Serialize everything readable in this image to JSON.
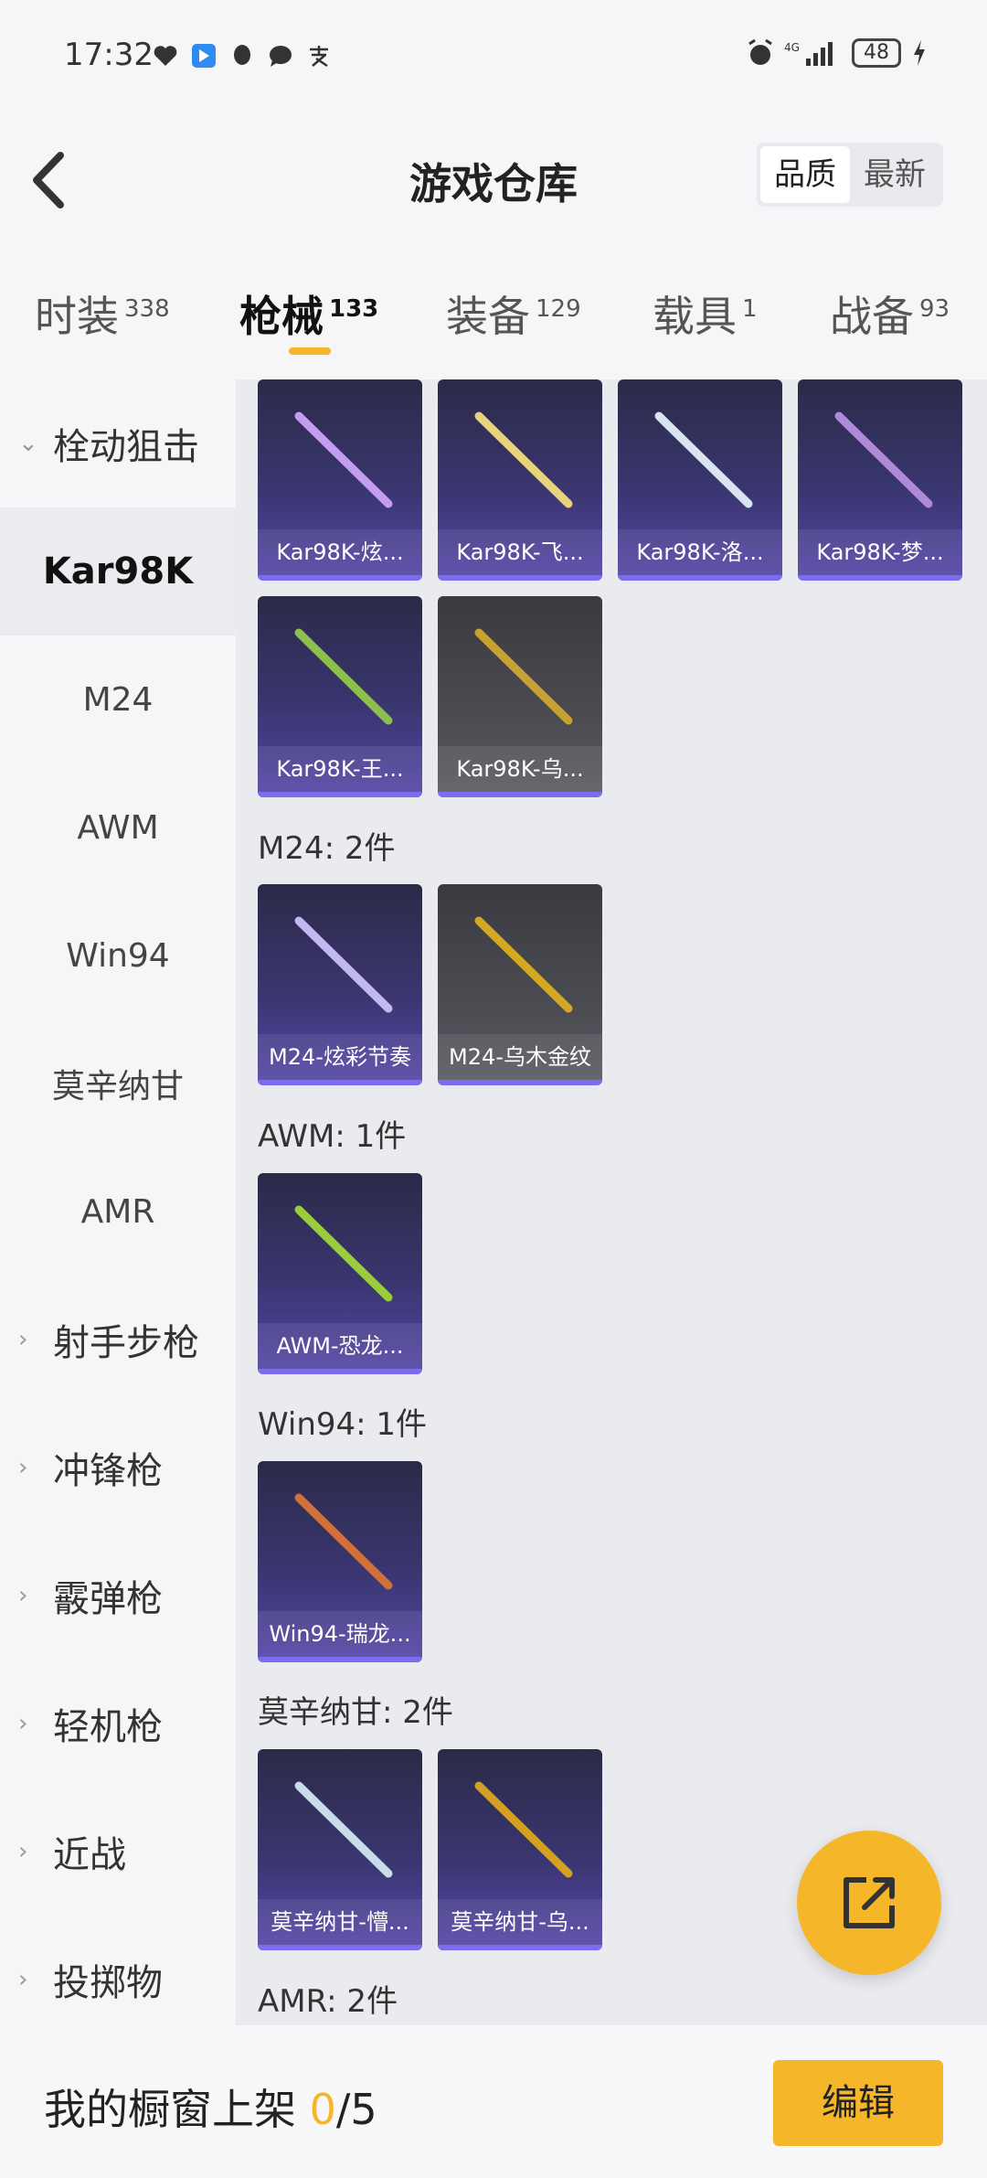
{
  "status_bar": {
    "time": "17:32",
    "battery": "48",
    "net": "4G"
  },
  "header": {
    "title": "游戏仓库",
    "sort_options": [
      "品质",
      "最新"
    ]
  },
  "tabs": [
    {
      "label": "时装",
      "count": "338"
    },
    {
      "label": "枪械",
      "count": "133"
    },
    {
      "label": "装备",
      "count": "129"
    },
    {
      "label": "载具",
      "count": "1"
    },
    {
      "label": "战备",
      "count": "93"
    }
  ],
  "sidebar": [
    {
      "label": "栓动狙击",
      "chevron": "⌄"
    },
    {
      "label": "Kar98K"
    },
    {
      "label": "M24"
    },
    {
      "label": "AWM"
    },
    {
      "label": "Win94"
    },
    {
      "label": "莫辛纳甘"
    },
    {
      "label": "AMR"
    },
    {
      "label": "射手步枪",
      "chevron": "›"
    },
    {
      "label": "冲锋枪",
      "chevron": "›"
    },
    {
      "label": "霰弹枪",
      "chevron": "›"
    },
    {
      "label": "轻机枪",
      "chevron": "›"
    },
    {
      "label": "近战",
      "chevron": "›"
    },
    {
      "label": "投掷物",
      "chevron": "›"
    }
  ],
  "sections": [
    "M24: 2件",
    "AWM: 1件",
    "Win94: 1件",
    "莫辛纳甘: 2件",
    "AMR: 2件"
  ],
  "items": [
    {
      "name": "Kar98K-炫...",
      "color": "#c49cf0"
    },
    {
      "name": "Kar98K-飞...",
      "color": "#e8d27a"
    },
    {
      "name": "Kar98K-洛...",
      "color": "#d8e4f0"
    },
    {
      "name": "Kar98K-梦...",
      "color": "#b08ad8"
    },
    {
      "name": "Kar98K-王...",
      "color": "#8cc04a"
    },
    {
      "name": "Kar98K-乌...",
      "color": "#c9a032"
    },
    {
      "name": "M24-炫彩节奏",
      "color": "#c4b8f0"
    },
    {
      "name": "M24-乌木金纹",
      "color": "#d4a820"
    },
    {
      "name": "AWM-恐龙...",
      "color": "#9ccc3c"
    },
    {
      "name": "Win94-瑞龙...",
      "color": "#d2703a"
    },
    {
      "name": "莫辛纳甘-懵...",
      "color": "#c8dcea"
    },
    {
      "name": "莫辛纳甘-乌...",
      "color": "#d4a020"
    }
  ],
  "bottom_bar": {
    "label": "我的橱窗上架",
    "count": "0",
    "total": "/5",
    "edit": "编辑"
  }
}
